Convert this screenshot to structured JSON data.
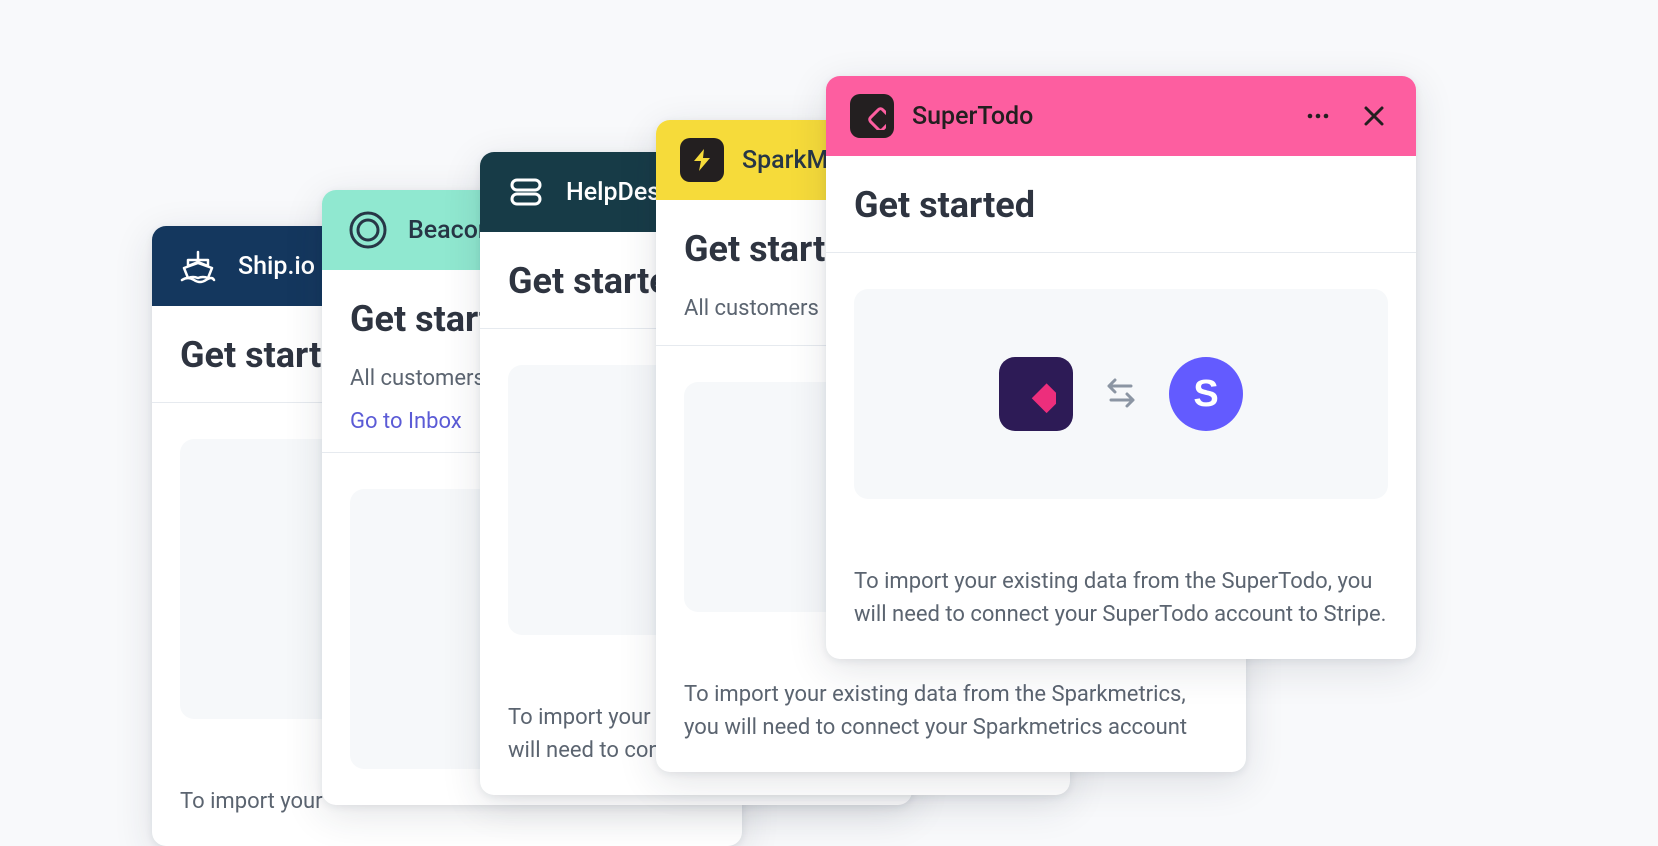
{
  "cards": [
    {
      "app": "Ship.io",
      "title": "Get started",
      "import_text": "To import your"
    },
    {
      "app": "Beacon",
      "title": "Get started",
      "subtitle": "All customers",
      "link": "Go to Inbox"
    },
    {
      "app": "HelpDesk",
      "title": "Get started",
      "import_text": "To import your existing data from the HelpDesk, you will need to connect your HelpDesk account"
    },
    {
      "app": "SparkMetrics",
      "title": "Get started",
      "subtitle": "All customers",
      "import_text": "To import your existing data from the Sparkmetrics, you will need to connect your Sparkmetrics account"
    },
    {
      "app": "SuperTodo",
      "title": "Get started",
      "import_text": "To import your existing data from the SuperTodo, you will need to connect your SuperTodo account to Stripe.",
      "partner_initial": "S"
    }
  ]
}
